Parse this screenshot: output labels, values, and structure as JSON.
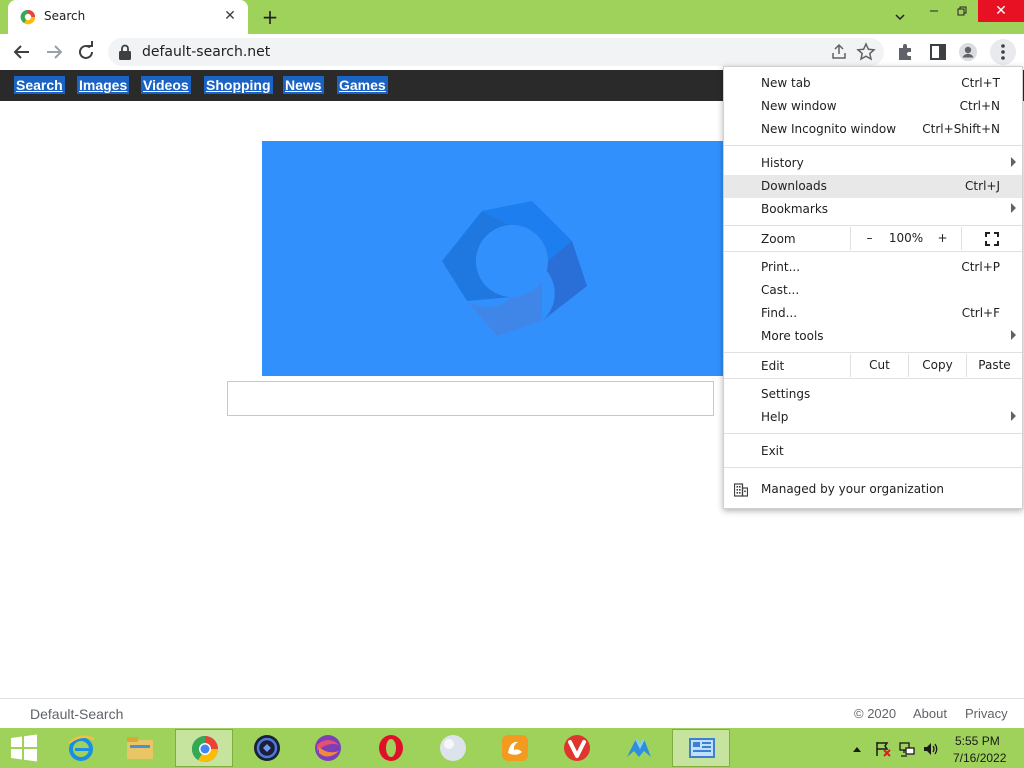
{
  "browser": {
    "tab_title": "Search",
    "url": "default-search.net"
  },
  "page": {
    "nav_links": [
      "Search",
      "Images",
      "Videos",
      "Shopping",
      "News",
      "Games"
    ],
    "footer": {
      "brand": "Default-Search",
      "copyright": "© 2020",
      "about": "About",
      "privacy": "Privacy"
    },
    "banner_color": "#3290fc"
  },
  "menu": {
    "new_tab": {
      "label": "New tab",
      "shortcut": "Ctrl+T"
    },
    "new_window": {
      "label": "New window",
      "shortcut": "Ctrl+N"
    },
    "new_incognito": {
      "label": "New Incognito window",
      "shortcut": "Ctrl+Shift+N"
    },
    "history": {
      "label": "History"
    },
    "downloads": {
      "label": "Downloads",
      "shortcut": "Ctrl+J"
    },
    "bookmarks": {
      "label": "Bookmarks"
    },
    "zoom": {
      "label": "Zoom",
      "minus": "–",
      "value": "100%",
      "plus": "+"
    },
    "print": {
      "label": "Print...",
      "shortcut": "Ctrl+P"
    },
    "cast": {
      "label": "Cast..."
    },
    "find": {
      "label": "Find...",
      "shortcut": "Ctrl+F"
    },
    "more_tools": {
      "label": "More tools"
    },
    "edit": {
      "label": "Edit",
      "cut": "Cut",
      "copy": "Copy",
      "paste": "Paste"
    },
    "settings": {
      "label": "Settings"
    },
    "help": {
      "label": "Help"
    },
    "exit": {
      "label": "Exit"
    },
    "managed": {
      "label": "Managed by your organization"
    }
  },
  "taskbar": {
    "apps": [
      "internet-explorer",
      "file-explorer",
      "chrome",
      "app-dark",
      "app-swirl",
      "opera",
      "app-orb",
      "uc-browser",
      "vivaldi",
      "app-wing",
      "control-panel"
    ],
    "active_app": "chrome",
    "time": "5:55 PM",
    "date": "7/16/2022"
  },
  "colors": {
    "frame": "#9fd25a",
    "nav_bar": "#2a2a2a",
    "nav_link_bg": "#1a63c4",
    "close_button": "#e81123"
  }
}
